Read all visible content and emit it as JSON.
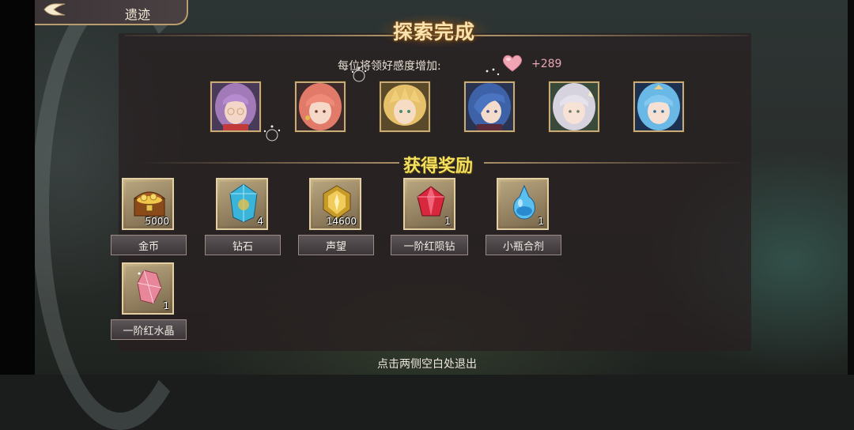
{
  "header": {
    "back_label": "遗迹",
    "title": "探索完成"
  },
  "affinity": {
    "label": "每位将领好感度增加:",
    "value": "+289"
  },
  "portraits": [
    {
      "name": "purple-hair-glasses-girl"
    },
    {
      "name": "pink-hair-girl"
    },
    {
      "name": "blonde-boy"
    },
    {
      "name": "blue-hair-lady"
    },
    {
      "name": "silver-hair-girl"
    },
    {
      "name": "light-blue-hair-girl"
    }
  ],
  "rewards": {
    "title": "获得奖励",
    "items": [
      {
        "name": "金币",
        "count": "5000",
        "icon": "treasure-chest-icon"
      },
      {
        "name": "钻石",
        "count": "4",
        "icon": "blue-crystal-icon"
      },
      {
        "name": "声望",
        "count": "14600",
        "icon": "gold-emblem-icon"
      },
      {
        "name": "一阶红陨钻",
        "count": "1",
        "icon": "red-gem-icon"
      },
      {
        "name": "小瓶合剂",
        "count": "1",
        "icon": "potion-bottle-icon"
      },
      {
        "name": "一阶红水晶",
        "count": "1",
        "icon": "pink-crystal-icon"
      }
    ]
  },
  "footer": {
    "exit_hint": "点击两侧空白处退出"
  },
  "colors": {
    "accent_gold": "#c8ad7a",
    "rewards_title": "#f5e05e",
    "affinity_value": "#e8a8b4"
  }
}
